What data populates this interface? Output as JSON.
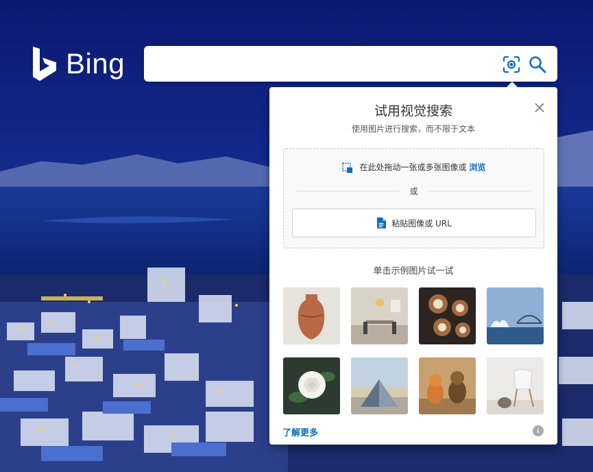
{
  "brand": {
    "name": "Bing",
    "accent": "#0f6cbd"
  },
  "search": {
    "value": "",
    "placeholder": "",
    "visual_search_icon": "camera-scan-icon",
    "search_icon": "magnifier-icon"
  },
  "visual_search": {
    "title": "试用视觉搜索",
    "subtitle": "使用图片进行搜索，而不限于文本",
    "drop_text": "在此处拖动一张或多张图像或",
    "browse_link": "浏览",
    "or_text": "或",
    "paste_label": "粘贴图像或 URL",
    "samples_label": "单击示例图片试一试",
    "samples": [
      "vase",
      "dining-room",
      "latte-art",
      "opera-house",
      "rose",
      "louvre-pyramid",
      "dogs",
      "chair"
    ],
    "learn_more": "了解更多",
    "info_icon": "i"
  }
}
